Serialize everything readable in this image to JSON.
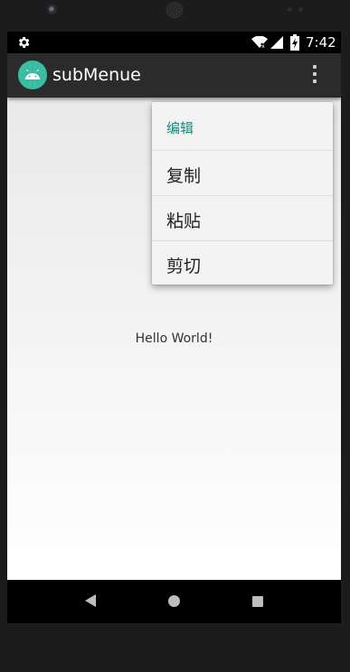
{
  "status_bar": {
    "time": "7:42"
  },
  "app_bar": {
    "title": "subMenue",
    "icon": "android-robot-icon"
  },
  "menu": {
    "header": "编辑",
    "items": [
      {
        "label": "复制"
      },
      {
        "label": "粘贴"
      },
      {
        "label": "剪切"
      }
    ]
  },
  "content": {
    "message": "Hello World!"
  },
  "colors": {
    "accent": "#158d80",
    "app_bar": "#2b2b2b",
    "app_icon_bg": "#3dbfa7",
    "menu_bg": "#f3f3f3"
  },
  "icons": [
    "gear-icon",
    "wifi-icon",
    "signal-icon",
    "battery-charging-icon",
    "android-robot-icon",
    "overflow-menu-icon",
    "back-icon",
    "home-icon",
    "recents-icon"
  ]
}
